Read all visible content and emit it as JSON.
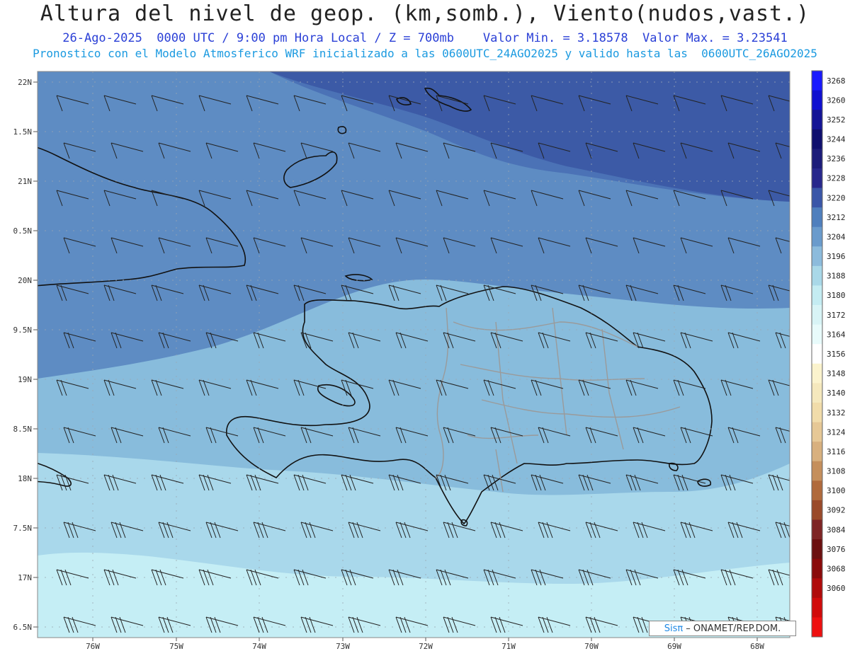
{
  "title": "Altura del nivel de geop. (km,somb.), Viento(nudos,vast.)",
  "subtitle_line1": "26-Ago-2025  0000 UTC / 9:00 pm Hora Local / Z = 700mb    Valor Min. = 3.18578  Valor Max. = 3.23541",
  "subtitle_line2": "Pronostico con el Modelo Atmosferico WRF inicializado a las 0600UTC_24AGO2025 y valido hasta las  0600UTC_26AGO2025",
  "lat_labels": [
    "22N",
    "1.5N",
    "21N",
    "0.5N",
    "20N",
    "9.5N",
    "19N",
    "8.5N",
    "18N",
    "7.5N",
    "17N",
    "6.5N"
  ],
  "lon_labels": [
    "76W",
    "75W",
    "74W",
    "73W",
    "72W",
    "71W",
    "70W",
    "69W",
    "68W"
  ],
  "colorbar": {
    "labels": [
      "3268",
      "3260",
      "3252",
      "3244",
      "3236",
      "3228",
      "3220",
      "3212",
      "3204",
      "3196",
      "3188",
      "3180",
      "3172",
      "3164",
      "3156",
      "3148",
      "3140",
      "3132",
      "3124",
      "3116",
      "3108",
      "3100",
      "3092",
      "3084",
      "3076",
      "3068",
      "3060"
    ],
    "colors": [
      "#1a1aff",
      "#1010d0",
      "#141496",
      "#0f0f6e",
      "#1c1c7a",
      "#27278c",
      "#3a56a8",
      "#4f7fbd",
      "#6a9bcc",
      "#8cbbdc",
      "#a9d8e8",
      "#c4ecf2",
      "#d8f4f6",
      "#e8fbfb",
      "#ffffff",
      "#fbf3cd",
      "#f5e8bd",
      "#f1dcaa",
      "#e6c896",
      "#d8b07e",
      "#c58f5c",
      "#b06a3c",
      "#9a4a2a",
      "#7e2424",
      "#6c1010",
      "#8a0a0a",
      "#b00a0a",
      "#d10a0a",
      "#ee1010"
    ]
  },
  "credit": {
    "sis": "Sisπ",
    "org": "– ONAMET/REP.DOM."
  },
  "colors": {
    "band_top": "#3c5aa6",
    "band_2": "#4b72b6",
    "band_3": "#5e8cc3",
    "band_4": "#88bcdc",
    "band_5": "#a9d8eb",
    "band_6": "#c5eef5"
  }
}
